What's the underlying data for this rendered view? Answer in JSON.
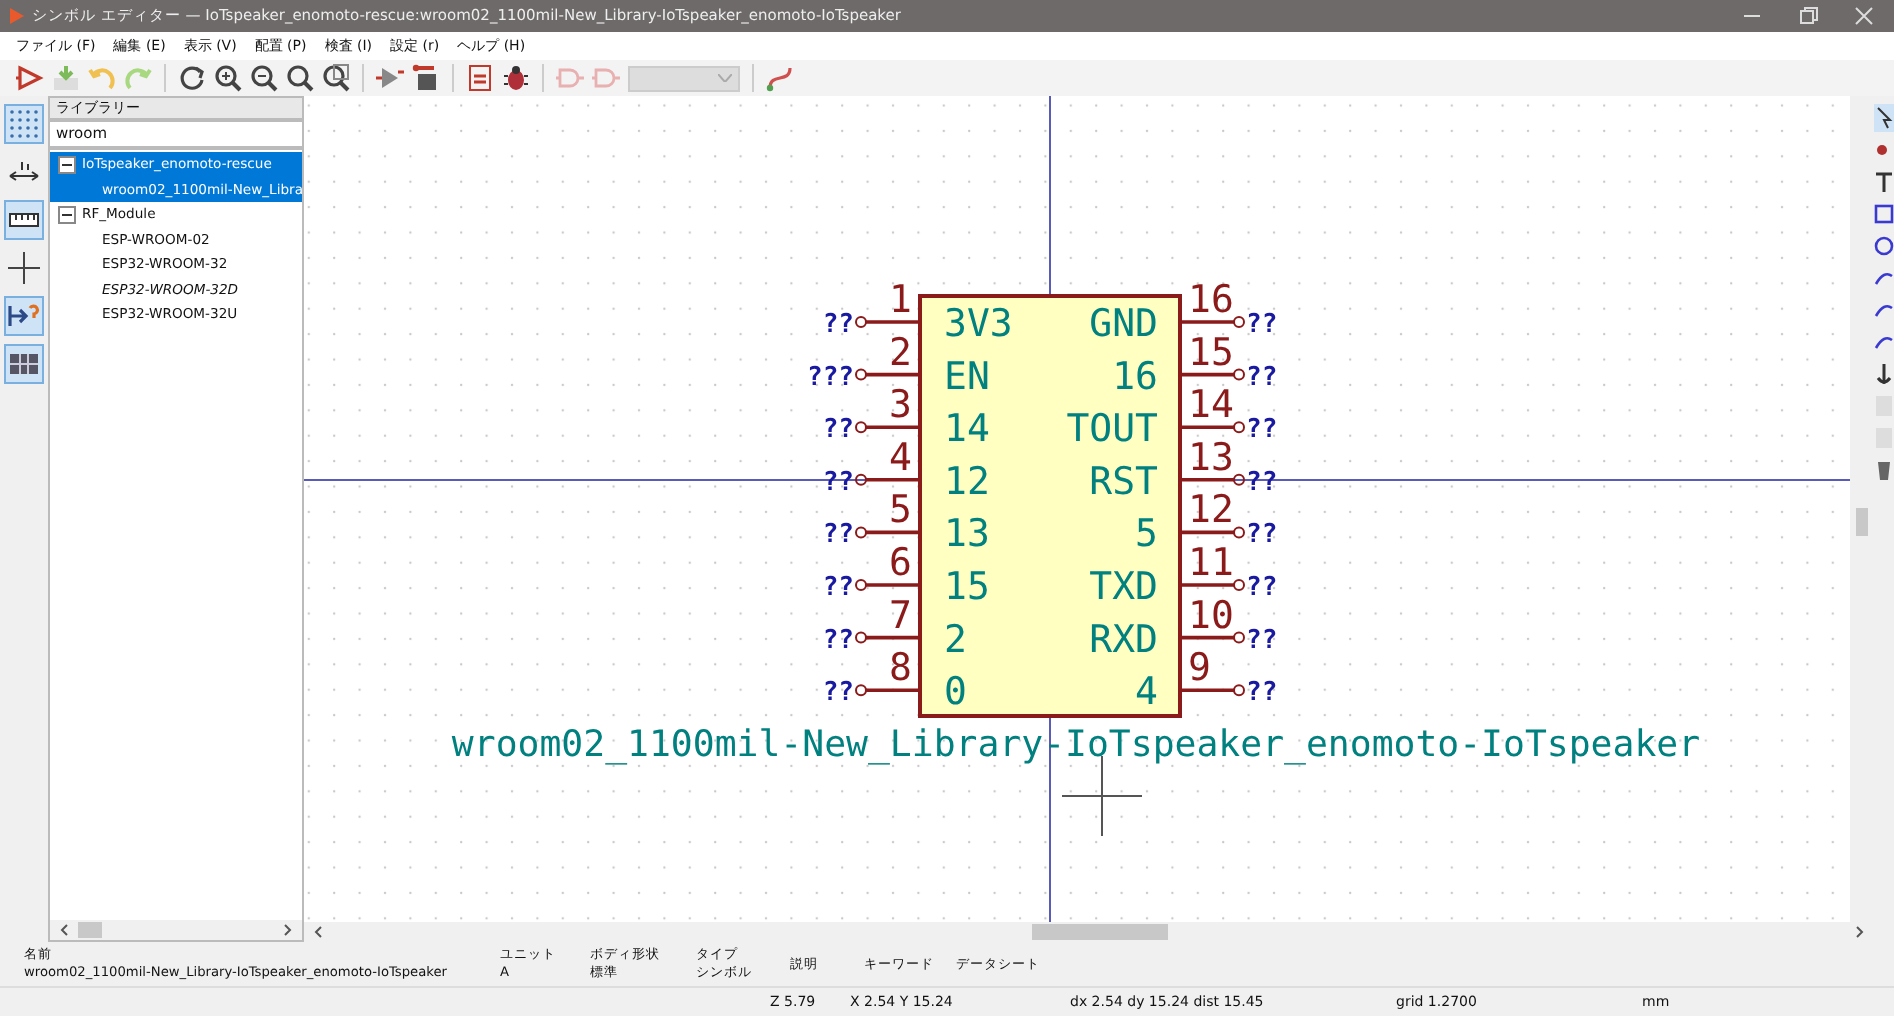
{
  "window": {
    "title": "シンボル エディター — IoTspeaker_enomoto-rescue:wroom02_1100mil-New_Library-IoTspeaker_enomoto-IoTspeaker"
  },
  "menu": [
    "ファイル (F)",
    "編集 (E)",
    "表示 (V)",
    "配置 (P)",
    "検査 (I)",
    "設定 (r)",
    "ヘルプ (H)"
  ],
  "left_toolbar": [
    {
      "on": true
    },
    {
      "on": false
    },
    {
      "on": true
    },
    {
      "on": false
    },
    {
      "on": true
    },
    {
      "on": true
    }
  ],
  "library_panel": {
    "title": "ライブラリー",
    "search": "wroom",
    "tree": [
      {
        "label": "IoTspeaker_enomoto-rescue",
        "expanded": true,
        "selected": true,
        "children": [
          {
            "label": "wroom02_1100mil-New_Libra",
            "selected": true,
            "italic": false
          }
        ]
      },
      {
        "label": "RF_Module",
        "expanded": true,
        "selected": false,
        "children": [
          {
            "label": "ESP-WROOM-02",
            "selected": false,
            "italic": false
          },
          {
            "label": "ESP32-WROOM-32",
            "selected": false,
            "italic": false
          },
          {
            "label": "ESP32-WROOM-32D",
            "selected": false,
            "italic": true
          },
          {
            "label": "ESP32-WROOM-32U",
            "selected": false,
            "italic": false
          }
        ]
      }
    ]
  },
  "symbol": {
    "name": "wroom02_1100mil-New_Library-IoTspeaker_enomoto-IoTspeaker",
    "pins_left": [
      {
        "number": "1",
        "name": "3V3",
        "net": "??"
      },
      {
        "number": "2",
        "name": "EN",
        "net": "???"
      },
      {
        "number": "3",
        "name": "14",
        "net": "??"
      },
      {
        "number": "4",
        "name": "12",
        "net": "??"
      },
      {
        "number": "5",
        "name": "13",
        "net": "??"
      },
      {
        "number": "6",
        "name": "15",
        "net": "??"
      },
      {
        "number": "7",
        "name": "2",
        "net": "??"
      },
      {
        "number": "8",
        "name": "0",
        "net": "??"
      }
    ],
    "pins_right": [
      {
        "number": "16",
        "name": "GND",
        "net": "??"
      },
      {
        "number": "15",
        "name": "16",
        "net": "??"
      },
      {
        "number": "14",
        "name": "TOUT",
        "net": "??"
      },
      {
        "number": "13",
        "name": "RST",
        "net": "??"
      },
      {
        "number": "12",
        "name": "5",
        "net": "??"
      },
      {
        "number": "11",
        "name": "TXD",
        "net": "??"
      },
      {
        "number": "10",
        "name": "RXD",
        "net": "??"
      },
      {
        "number": "9",
        "name": "4",
        "net": "??"
      }
    ]
  },
  "info_panel": [
    {
      "label": "名前",
      "value": "wroom02_1100mil-New_Library-IoTspeaker_enomoto-IoTspeaker"
    },
    {
      "label": "ユニット",
      "value": "A"
    },
    {
      "label": "ボディ形状",
      "value": "標準"
    },
    {
      "label": "タイプ",
      "value": "シンボル"
    },
    {
      "label": "説明"
    },
    {
      "label": "キーワード"
    },
    {
      "label": "データシート"
    }
  ],
  "status_bar": [
    "Z 5.79",
    "X 2.54  Y 15.24",
    "dx 2.54  dy 15.24  dist 15.45",
    "grid 1.2700",
    "mm"
  ]
}
